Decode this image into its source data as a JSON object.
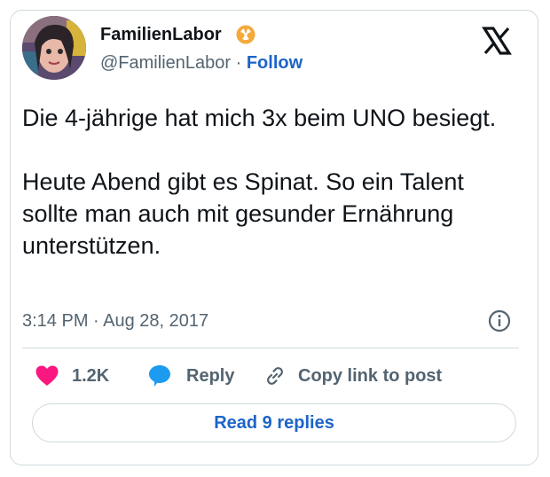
{
  "author": {
    "display_name": "FamilienLabor",
    "handle": "@FamilienLabor",
    "separator": "·",
    "follow_label": "Follow",
    "badge_icon": "radioactive-icon"
  },
  "tweet": {
    "paragraphs": [
      "Die 4-jährige hat mich 3x beim UNO besiegt.",
      "Heute Abend gibt es Spinat. So ein Talent sollte man auch mit gesunder Ernährung unterstützen."
    ],
    "timestamp": "3:14 PM · Aug 28, 2017"
  },
  "actions": {
    "like_count": "1.2K",
    "reply_label": "Reply",
    "copy_label": "Copy link to post"
  },
  "read_replies_label": "Read 9 replies",
  "colors": {
    "link": "#1d64c8",
    "like": "#f91880",
    "reply": "#1d9bf0",
    "muted": "#536471",
    "badge": "#f4a93a"
  }
}
